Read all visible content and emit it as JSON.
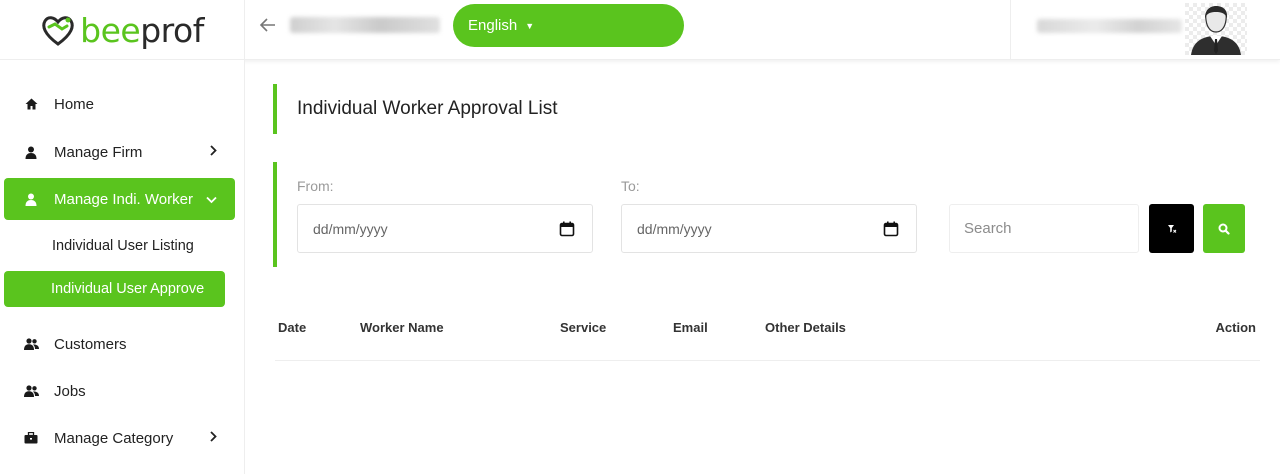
{
  "brand": {
    "part1": "bee",
    "part2": "prof"
  },
  "header": {
    "language": "English"
  },
  "sidebar": {
    "items": [
      {
        "label": "Home"
      },
      {
        "label": "Manage Firm"
      },
      {
        "label": "Manage Indi. Worker"
      },
      {
        "label": "Customers"
      },
      {
        "label": "Jobs"
      },
      {
        "label": "Manage Category"
      }
    ],
    "subitems": [
      {
        "label": "Individual User Listing"
      },
      {
        "label": "Individual User Approve"
      }
    ]
  },
  "page": {
    "title": "Individual Worker Approval List"
  },
  "filters": {
    "from_label": "From:",
    "to_label": "To:",
    "from_value": "dd/mm/yyyy",
    "to_value": "dd/mm/yyyy",
    "search_placeholder": "Search"
  },
  "table": {
    "columns": [
      "Date",
      "Worker Name",
      "Service",
      "Email",
      "Other Details",
      "Action"
    ],
    "rows": []
  },
  "colors": {
    "accent": "#5ac41e",
    "filter_button": "#000000"
  }
}
